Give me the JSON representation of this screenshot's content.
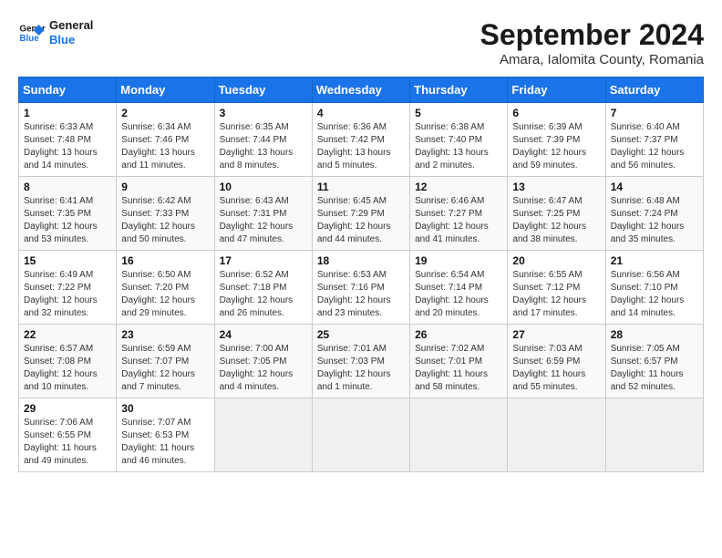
{
  "header": {
    "logo_line1": "General",
    "logo_line2": "Blue",
    "month_title": "September 2024",
    "location": "Amara, Ialomita County, Romania"
  },
  "columns": [
    "Sunday",
    "Monday",
    "Tuesday",
    "Wednesday",
    "Thursday",
    "Friday",
    "Saturday"
  ],
  "weeks": [
    [
      {
        "day": "1",
        "lines": [
          "Sunrise: 6:33 AM",
          "Sunset: 7:48 PM",
          "Daylight: 13 hours",
          "and 14 minutes."
        ]
      },
      {
        "day": "2",
        "lines": [
          "Sunrise: 6:34 AM",
          "Sunset: 7:46 PM",
          "Daylight: 13 hours",
          "and 11 minutes."
        ]
      },
      {
        "day": "3",
        "lines": [
          "Sunrise: 6:35 AM",
          "Sunset: 7:44 PM",
          "Daylight: 13 hours",
          "and 8 minutes."
        ]
      },
      {
        "day": "4",
        "lines": [
          "Sunrise: 6:36 AM",
          "Sunset: 7:42 PM",
          "Daylight: 13 hours",
          "and 5 minutes."
        ]
      },
      {
        "day": "5",
        "lines": [
          "Sunrise: 6:38 AM",
          "Sunset: 7:40 PM",
          "Daylight: 13 hours",
          "and 2 minutes."
        ]
      },
      {
        "day": "6",
        "lines": [
          "Sunrise: 6:39 AM",
          "Sunset: 7:39 PM",
          "Daylight: 12 hours",
          "and 59 minutes."
        ]
      },
      {
        "day": "7",
        "lines": [
          "Sunrise: 6:40 AM",
          "Sunset: 7:37 PM",
          "Daylight: 12 hours",
          "and 56 minutes."
        ]
      }
    ],
    [
      {
        "day": "8",
        "lines": [
          "Sunrise: 6:41 AM",
          "Sunset: 7:35 PM",
          "Daylight: 12 hours",
          "and 53 minutes."
        ]
      },
      {
        "day": "9",
        "lines": [
          "Sunrise: 6:42 AM",
          "Sunset: 7:33 PM",
          "Daylight: 12 hours",
          "and 50 minutes."
        ]
      },
      {
        "day": "10",
        "lines": [
          "Sunrise: 6:43 AM",
          "Sunset: 7:31 PM",
          "Daylight: 12 hours",
          "and 47 minutes."
        ]
      },
      {
        "day": "11",
        "lines": [
          "Sunrise: 6:45 AM",
          "Sunset: 7:29 PM",
          "Daylight: 12 hours",
          "and 44 minutes."
        ]
      },
      {
        "day": "12",
        "lines": [
          "Sunrise: 6:46 AM",
          "Sunset: 7:27 PM",
          "Daylight: 12 hours",
          "and 41 minutes."
        ]
      },
      {
        "day": "13",
        "lines": [
          "Sunrise: 6:47 AM",
          "Sunset: 7:25 PM",
          "Daylight: 12 hours",
          "and 38 minutes."
        ]
      },
      {
        "day": "14",
        "lines": [
          "Sunrise: 6:48 AM",
          "Sunset: 7:24 PM",
          "Daylight: 12 hours",
          "and 35 minutes."
        ]
      }
    ],
    [
      {
        "day": "15",
        "lines": [
          "Sunrise: 6:49 AM",
          "Sunset: 7:22 PM",
          "Daylight: 12 hours",
          "and 32 minutes."
        ]
      },
      {
        "day": "16",
        "lines": [
          "Sunrise: 6:50 AM",
          "Sunset: 7:20 PM",
          "Daylight: 12 hours",
          "and 29 minutes."
        ]
      },
      {
        "day": "17",
        "lines": [
          "Sunrise: 6:52 AM",
          "Sunset: 7:18 PM",
          "Daylight: 12 hours",
          "and 26 minutes."
        ]
      },
      {
        "day": "18",
        "lines": [
          "Sunrise: 6:53 AM",
          "Sunset: 7:16 PM",
          "Daylight: 12 hours",
          "and 23 minutes."
        ]
      },
      {
        "day": "19",
        "lines": [
          "Sunrise: 6:54 AM",
          "Sunset: 7:14 PM",
          "Daylight: 12 hours",
          "and 20 minutes."
        ]
      },
      {
        "day": "20",
        "lines": [
          "Sunrise: 6:55 AM",
          "Sunset: 7:12 PM",
          "Daylight: 12 hours",
          "and 17 minutes."
        ]
      },
      {
        "day": "21",
        "lines": [
          "Sunrise: 6:56 AM",
          "Sunset: 7:10 PM",
          "Daylight: 12 hours",
          "and 14 minutes."
        ]
      }
    ],
    [
      {
        "day": "22",
        "lines": [
          "Sunrise: 6:57 AM",
          "Sunset: 7:08 PM",
          "Daylight: 12 hours",
          "and 10 minutes."
        ]
      },
      {
        "day": "23",
        "lines": [
          "Sunrise: 6:59 AM",
          "Sunset: 7:07 PM",
          "Daylight: 12 hours",
          "and 7 minutes."
        ]
      },
      {
        "day": "24",
        "lines": [
          "Sunrise: 7:00 AM",
          "Sunset: 7:05 PM",
          "Daylight: 12 hours",
          "and 4 minutes."
        ]
      },
      {
        "day": "25",
        "lines": [
          "Sunrise: 7:01 AM",
          "Sunset: 7:03 PM",
          "Daylight: 12 hours",
          "and 1 minute."
        ]
      },
      {
        "day": "26",
        "lines": [
          "Sunrise: 7:02 AM",
          "Sunset: 7:01 PM",
          "Daylight: 11 hours",
          "and 58 minutes."
        ]
      },
      {
        "day": "27",
        "lines": [
          "Sunrise: 7:03 AM",
          "Sunset: 6:59 PM",
          "Daylight: 11 hours",
          "and 55 minutes."
        ]
      },
      {
        "day": "28",
        "lines": [
          "Sunrise: 7:05 AM",
          "Sunset: 6:57 PM",
          "Daylight: 11 hours",
          "and 52 minutes."
        ]
      }
    ],
    [
      {
        "day": "29",
        "lines": [
          "Sunrise: 7:06 AM",
          "Sunset: 6:55 PM",
          "Daylight: 11 hours",
          "and 49 minutes."
        ]
      },
      {
        "day": "30",
        "lines": [
          "Sunrise: 7:07 AM",
          "Sunset: 6:53 PM",
          "Daylight: 11 hours",
          "and 46 minutes."
        ]
      },
      {
        "day": "",
        "lines": []
      },
      {
        "day": "",
        "lines": []
      },
      {
        "day": "",
        "lines": []
      },
      {
        "day": "",
        "lines": []
      },
      {
        "day": "",
        "lines": []
      }
    ]
  ]
}
